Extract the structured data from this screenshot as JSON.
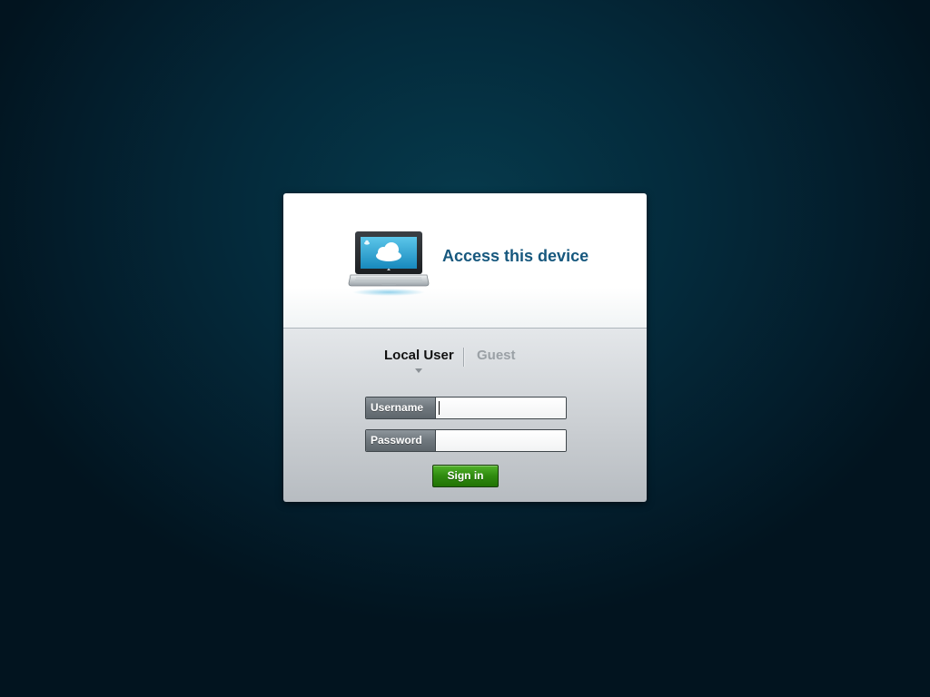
{
  "dialog": {
    "title": "Access this device",
    "image_icon": "laptop-cloud-icon"
  },
  "tabs": [
    {
      "label": "Local User",
      "selected": true
    },
    {
      "label": "Guest",
      "selected": false
    }
  ],
  "form": {
    "username": {
      "label": "Username",
      "value": "",
      "placeholder": ""
    },
    "password": {
      "label": "Password",
      "value": "",
      "placeholder": ""
    },
    "submit_label": "Sign in"
  },
  "colors": {
    "title": "#17587e",
    "accent_green": "#2f8a10",
    "background": "#042a3b"
  }
}
